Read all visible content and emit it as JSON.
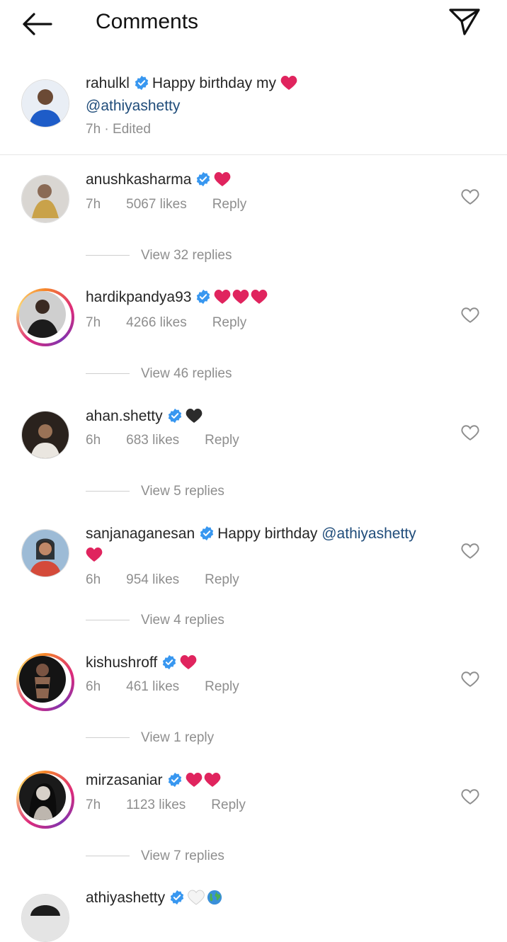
{
  "header": {
    "title": "Comments"
  },
  "caption": {
    "username": "rahulkl",
    "text": "Happy birthday my",
    "mention": "@athiyashetty",
    "time": "7h",
    "edited": "Edited"
  },
  "comments": [
    {
      "username": "anushkasharma",
      "text": "",
      "emojis": "red-heart",
      "time": "7h",
      "likes": "5067 likes",
      "reply": "Reply",
      "view_replies": "View 32 replies"
    },
    {
      "username": "hardikpandya93",
      "text": "",
      "emojis": "three-red-hearts",
      "time": "7h",
      "likes": "4266 likes",
      "reply": "Reply",
      "view_replies": "View 46 replies"
    },
    {
      "username": "ahan.shetty",
      "text": "",
      "emojis": "black-heart",
      "time": "6h",
      "likes": "683 likes",
      "reply": "Reply",
      "view_replies": "View 5 replies"
    },
    {
      "username": "sanjanaganesan",
      "text": "Happy birthday",
      "mention": "@athiyashetty",
      "emojis": "red-heart",
      "time": "6h",
      "likes": "954 likes",
      "reply": "Reply",
      "view_replies": "View 4 replies"
    },
    {
      "username": "kishushroff",
      "text": "",
      "emojis": "red-heart",
      "time": "6h",
      "likes": "461 likes",
      "reply": "Reply",
      "view_replies": "View 1 reply"
    },
    {
      "username": "mirzasaniar",
      "text": "",
      "emojis": "two-red-hearts",
      "time": "7h",
      "likes": "1123 likes",
      "reply": "Reply",
      "view_replies": "View 7 replies"
    },
    {
      "username": "athiyashetty",
      "text": "",
      "emojis": "white-heart-globe",
      "time": "",
      "likes": "",
      "reply": "",
      "view_replies": ""
    }
  ],
  "colors": {
    "verified": "#3897f0",
    "heart": "#e0245e",
    "mention": "#1f4c7a",
    "secondary": "#8e8e8e"
  }
}
